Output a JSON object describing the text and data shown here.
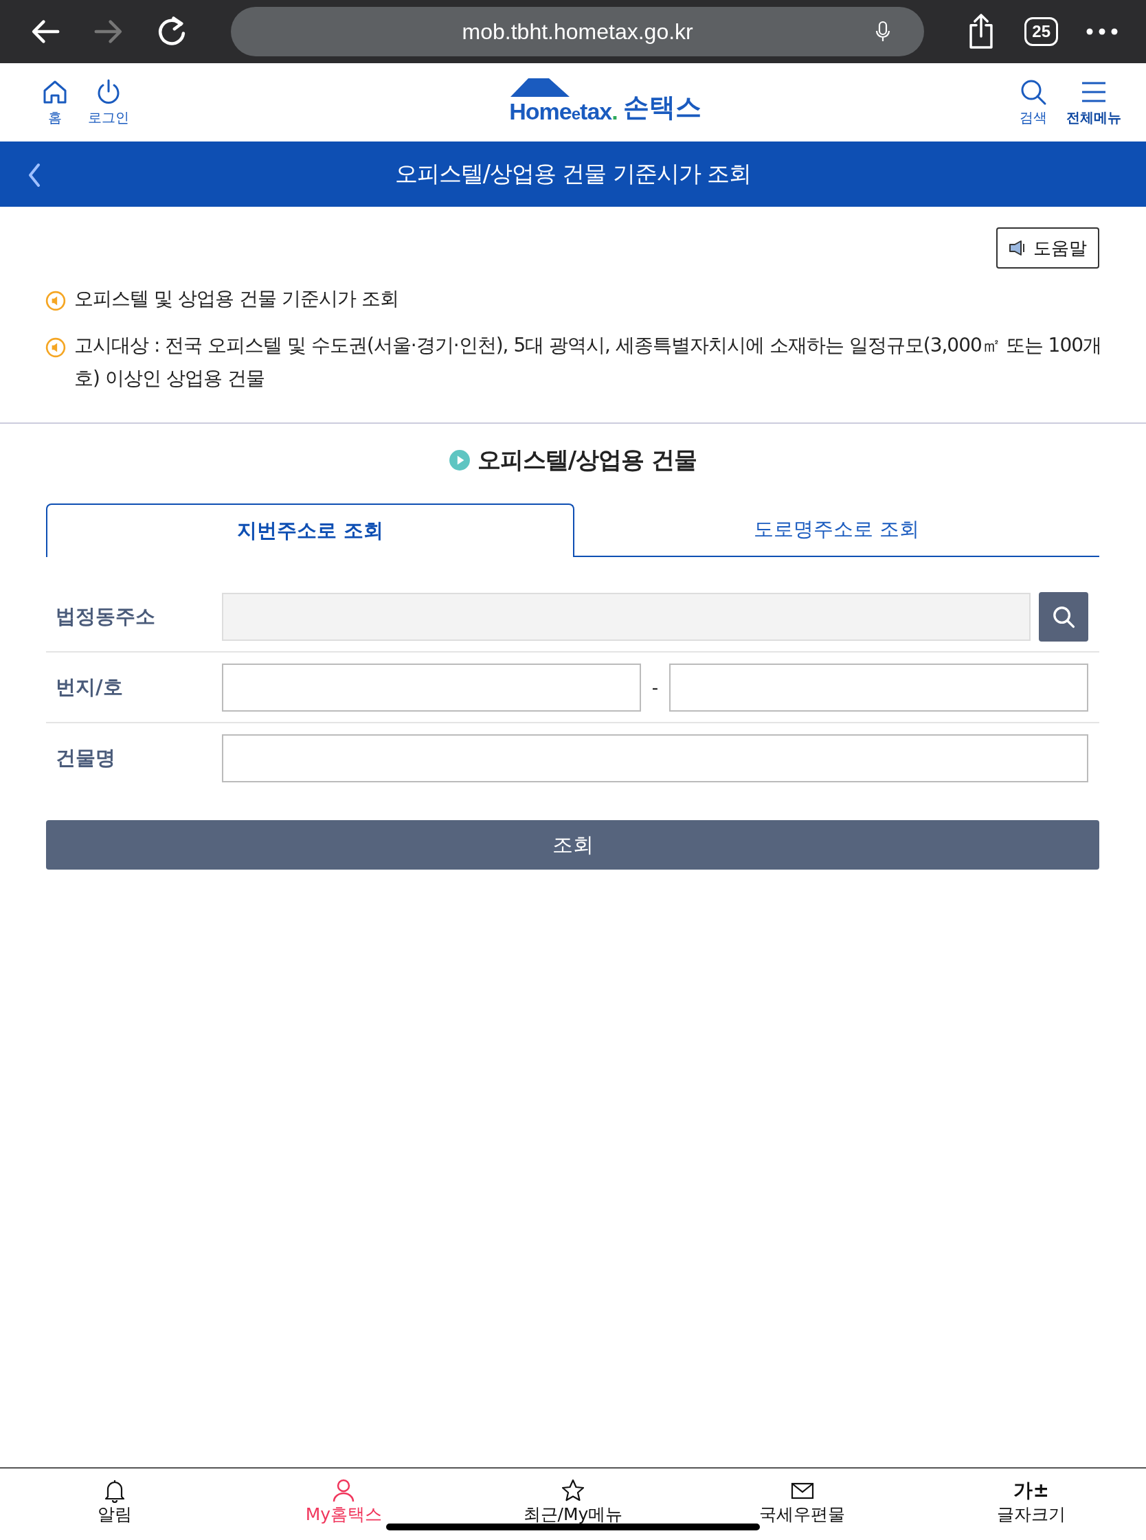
{
  "browser": {
    "url": "mob.tbht.hometax.go.kr",
    "tab_count": "25"
  },
  "header": {
    "left": [
      {
        "kind": "home",
        "label": "홈"
      },
      {
        "kind": "power",
        "label": "로그인"
      }
    ],
    "logo": {
      "word": "Home",
      "small": "e",
      "tail": "tax",
      "dot": ".",
      "name": "손택스"
    },
    "right": [
      {
        "kind": "search",
        "label": "검색"
      },
      {
        "kind": "menu",
        "label": "전체메뉴"
      }
    ]
  },
  "title_bar": {
    "title": "오피스텔/상업용 건물 기준시가 조회"
  },
  "help_button": "도움말",
  "notices": [
    "오피스텔 및 상업용 건물 기준시가 조회",
    "고시대상 : 전국 오피스텔 및 수도권(서울·경기·인천), 5대 광역시, 세종특별자치시에 소재하는 일정규모(3,000㎡ 또는 100개호) 이상인 상업용 건물"
  ],
  "section_title": "오피스텔/상업용 건물",
  "tabs": [
    {
      "label": "지번주소로 조회",
      "selected": true
    },
    {
      "label": "도로명주소로 조회",
      "selected": false
    }
  ],
  "form": [
    {
      "kind": "lookup",
      "label": "법정동주소"
    },
    {
      "kind": "pair",
      "label": "번지/호",
      "separator": "-"
    },
    {
      "kind": "text",
      "label": "건물명"
    }
  ],
  "submit": "조회",
  "bottom_nav": [
    {
      "kind": "bell",
      "label": "알림",
      "selected": false
    },
    {
      "kind": "person",
      "label": "My홈택스",
      "selected": true
    },
    {
      "kind": "star",
      "label": "최근/My메뉴",
      "selected": false
    },
    {
      "kind": "mail",
      "label": "국세우편물",
      "selected": false
    },
    {
      "kind": "font",
      "icon_text": "가±",
      "label": "글자크기",
      "selected": false
    }
  ]
}
